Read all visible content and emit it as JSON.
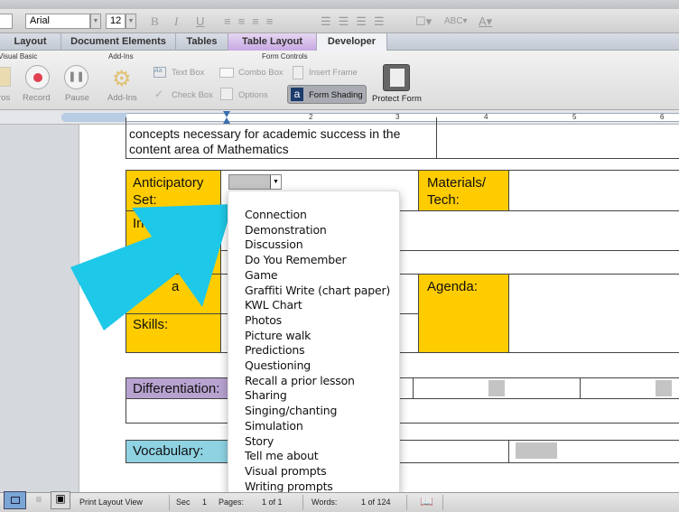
{
  "toolbar": {
    "font": "Arial",
    "size": "12",
    "bold": "B",
    "italic": "I",
    "underline": "U"
  },
  "tabs": [
    {
      "label": "Layout"
    },
    {
      "label": "Document Elements"
    },
    {
      "label": "Tables"
    },
    {
      "label": "Table Layout"
    },
    {
      "label": "Developer"
    }
  ],
  "ribbon": {
    "groups": {
      "vb": "Visual Basic",
      "addins": "Add-Ins",
      "form": "Form Controls"
    },
    "macros": "ros",
    "record": "Record",
    "pause": "Pause",
    "addins_btn": "Add-Ins",
    "text_box": "Text Box",
    "combo_box": "Combo Box",
    "insert_frame": "Insert Frame",
    "check_box": "Check Box",
    "options": "Options",
    "form_shading": "Form Shading",
    "protect_form": "Protect Form"
  },
  "ruler": {
    "marks": [
      "2",
      "3",
      "4",
      "5",
      "6"
    ]
  },
  "document": {
    "objective_line1": "concepts necessary for academic success in the",
    "objective_line2": "content area of Mathematics",
    "anticipatory": "Anticipatory Set:",
    "materials": "Materials/ Tech:",
    "input_partial": "In",
    "modeling_partial": "a    :",
    "agenda": "Agenda:",
    "skills": "Skills:",
    "differentiation": "Differentiation:",
    "vocabulary": "Vocabulary:"
  },
  "dropdown": {
    "options": [
      "Connection",
      "Demonstration",
      "Discussion",
      "Do You Remember",
      "Game",
      "Graffiti Write (chart paper)",
      "KWL Chart",
      "Photos",
      "Picture walk",
      "Predictions",
      "Questioning",
      "Recall a prior lesson",
      "Sharing",
      "Singing/chanting",
      "Simulation",
      "Story",
      "Tell me about",
      "Visual prompts",
      "Writing prompts"
    ]
  },
  "status": {
    "view": "Print Layout View",
    "sec_label": "Sec",
    "sec": "1",
    "pages_label": "Pages:",
    "pages": "1 of 1",
    "words_label": "Words:",
    "words": "1 of 124"
  },
  "colors": {
    "yellow": "#ffcc00",
    "purple": "#b8a3d0",
    "blue": "#8fd3e3",
    "arrow": "#1ec8e8"
  }
}
